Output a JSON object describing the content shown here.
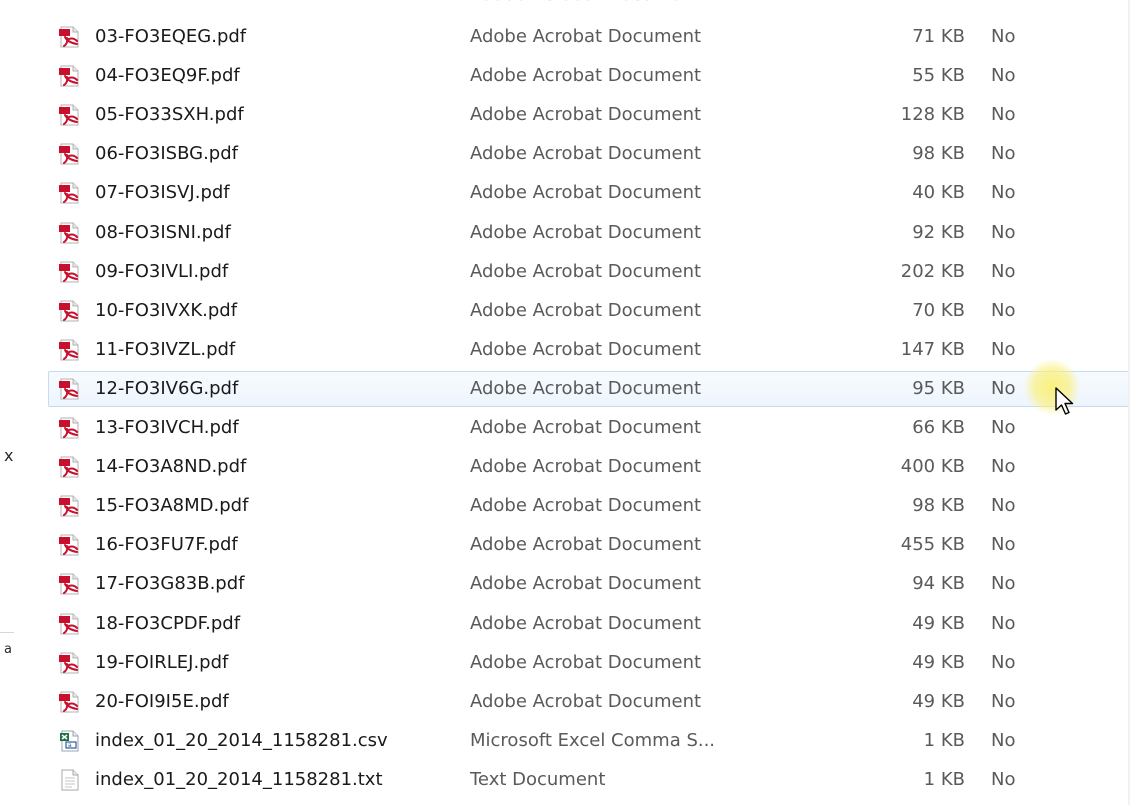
{
  "left_pane": {
    "fragments": [
      "x",
      "a"
    ]
  },
  "partial_top_row": {
    "type": "Adobe Acrobat Document"
  },
  "files": [
    {
      "name": "03-FO3EQEG.pdf",
      "type": "Adobe Acrobat Document",
      "size": "71 KB",
      "flag": "No",
      "icon": "pdf-icon"
    },
    {
      "name": "04-FO3EQ9F.pdf",
      "type": "Adobe Acrobat Document",
      "size": "55 KB",
      "flag": "No",
      "icon": "pdf-icon"
    },
    {
      "name": "05-FO33SXH.pdf",
      "type": "Adobe Acrobat Document",
      "size": "128 KB",
      "flag": "No",
      "icon": "pdf-icon"
    },
    {
      "name": "06-FO3ISBG.pdf",
      "type": "Adobe Acrobat Document",
      "size": "98 KB",
      "flag": "No",
      "icon": "pdf-icon"
    },
    {
      "name": "07-FO3ISVJ.pdf",
      "type": "Adobe Acrobat Document",
      "size": "40 KB",
      "flag": "No",
      "icon": "pdf-icon"
    },
    {
      "name": "08-FO3ISNI.pdf",
      "type": "Adobe Acrobat Document",
      "size": "92 KB",
      "flag": "No",
      "icon": "pdf-icon"
    },
    {
      "name": "09-FO3IVLI.pdf",
      "type": "Adobe Acrobat Document",
      "size": "202 KB",
      "flag": "No",
      "icon": "pdf-icon"
    },
    {
      "name": "10-FO3IVXK.pdf",
      "type": "Adobe Acrobat Document",
      "size": "70 KB",
      "flag": "No",
      "icon": "pdf-icon"
    },
    {
      "name": "11-FO3IVZL.pdf",
      "type": "Adobe Acrobat Document",
      "size": "147 KB",
      "flag": "No",
      "icon": "pdf-icon"
    },
    {
      "name": "12-FO3IV6G.pdf",
      "type": "Adobe Acrobat Document",
      "size": "95 KB",
      "flag": "No",
      "icon": "pdf-icon"
    },
    {
      "name": "13-FO3IVCH.pdf",
      "type": "Adobe Acrobat Document",
      "size": "66 KB",
      "flag": "No",
      "icon": "pdf-icon"
    },
    {
      "name": "14-FO3A8ND.pdf",
      "type": "Adobe Acrobat Document",
      "size": "400 KB",
      "flag": "No",
      "icon": "pdf-icon"
    },
    {
      "name": "15-FO3A8MD.pdf",
      "type": "Adobe Acrobat Document",
      "size": "98 KB",
      "flag": "No",
      "icon": "pdf-icon"
    },
    {
      "name": "16-FO3FU7F.pdf",
      "type": "Adobe Acrobat Document",
      "size": "455 KB",
      "flag": "No",
      "icon": "pdf-icon"
    },
    {
      "name": "17-FO3G83B.pdf",
      "type": "Adobe Acrobat Document",
      "size": "94 KB",
      "flag": "No",
      "icon": "pdf-icon"
    },
    {
      "name": "18-FO3CPDF.pdf",
      "type": "Adobe Acrobat Document",
      "size": "49 KB",
      "flag": "No",
      "icon": "pdf-icon"
    },
    {
      "name": "19-FOIRLEJ.pdf",
      "type": "Adobe Acrobat Document",
      "size": "49 KB",
      "flag": "No",
      "icon": "pdf-icon"
    },
    {
      "name": "20-FOI9I5E.pdf",
      "type": "Adobe Acrobat Document",
      "size": "49 KB",
      "flag": "No",
      "icon": "pdf-icon"
    },
    {
      "name": "index_01_20_2014_1158281.csv",
      "type": "Microsoft Excel Comma S...",
      "size": "1 KB",
      "flag": "No",
      "icon": "csv-icon"
    },
    {
      "name": "index_01_20_2014_1158281.txt",
      "type": "Text Document",
      "size": "1 KB",
      "flag": "No",
      "icon": "text-file-icon"
    }
  ],
  "hovered_row_index": 9,
  "colors": {
    "pdf_red": "#c8102e",
    "hover_border": "#c4dbf3",
    "hover_fill": "#eef5fd",
    "secondary_text": "#5a5a5a",
    "cursor_highlight": "#f5ec78"
  }
}
